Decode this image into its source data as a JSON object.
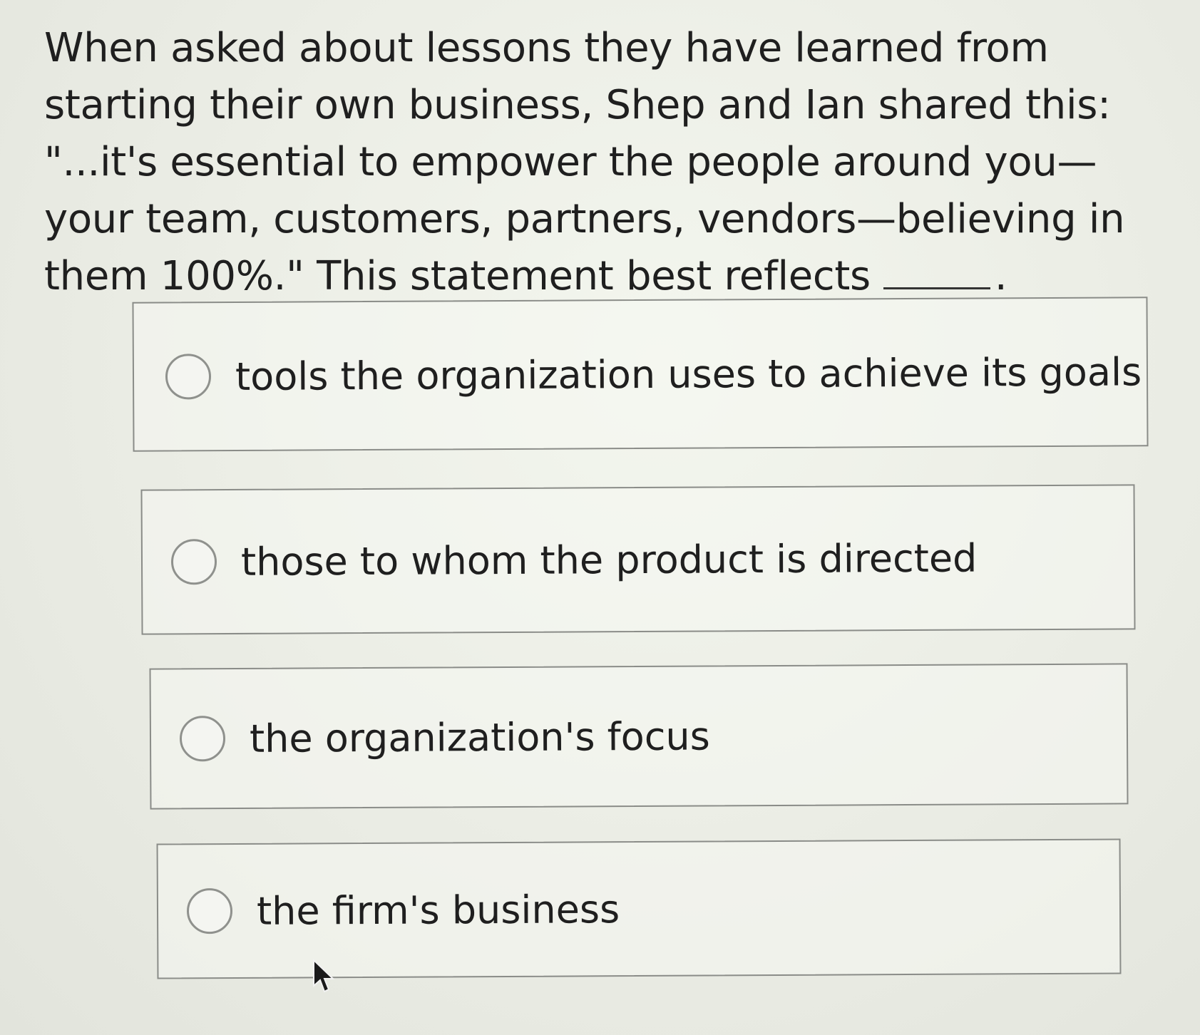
{
  "question": {
    "text_before_blank": "When asked about lessons they have learned from starting their own business, Shep and Ian shared this: \"...it's essential to empower the people around you—your team, customers, partners, vendors—believing in them 100%.\" This statement best reflects",
    "text_after_blank": "."
  },
  "options": [
    {
      "label": "tools the organization uses to achieve its goals",
      "selected": false
    },
    {
      "label": "those to whom the product is directed",
      "selected": false
    },
    {
      "label": "the organization's focus",
      "selected": false
    },
    {
      "label": "the firm's business",
      "selected": false
    }
  ],
  "icons": {
    "radio": "radio-unselected-icon",
    "cursor": "mouse-pointer-icon"
  }
}
